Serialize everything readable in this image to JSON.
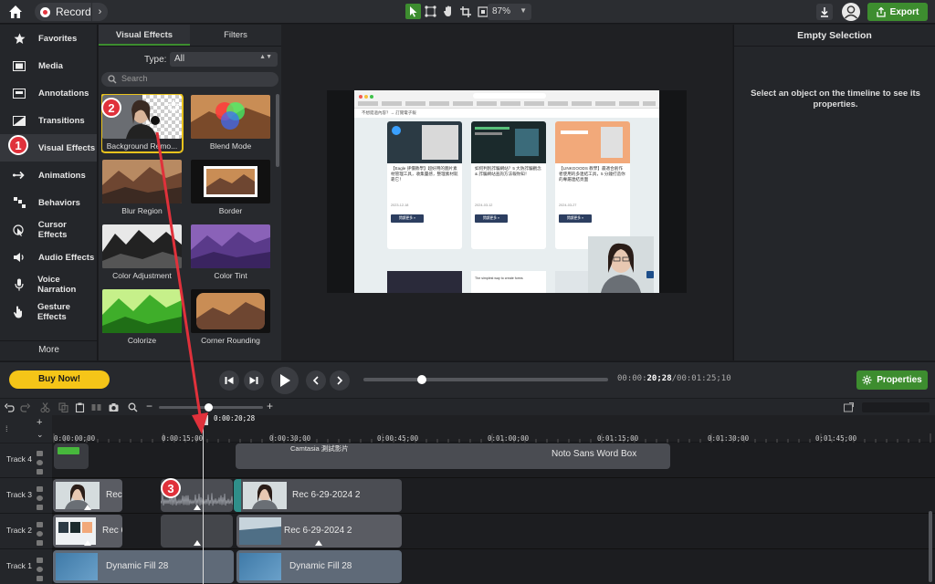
{
  "topbar": {
    "record_label": "Record",
    "zoom_value": "87%",
    "export_label": "Export"
  },
  "nav": {
    "items": [
      {
        "label": "Favorites",
        "icon": "star-icon"
      },
      {
        "label": "Media",
        "icon": "film-icon"
      },
      {
        "label": "Annotations",
        "icon": "annotation-icon"
      },
      {
        "label": "Transitions",
        "icon": "transition-icon"
      },
      {
        "label": "Visual Effects",
        "icon": "sparkle-icon"
      },
      {
        "label": "Animations",
        "icon": "arrow-icon"
      },
      {
        "label": "Behaviors",
        "icon": "behaviors-icon"
      },
      {
        "label": "Cursor Effects",
        "icon": "cursor-icon"
      },
      {
        "label": "Audio Effects",
        "icon": "speaker-icon"
      },
      {
        "label": "Voice Narration",
        "icon": "microphone-icon"
      },
      {
        "label": "Gesture Effects",
        "icon": "hand-icon"
      }
    ],
    "more_label": "More"
  },
  "effects": {
    "tab_visual": "Visual Effects",
    "tab_filters": "Filters",
    "type_label": "Type:",
    "type_value": "All",
    "search_placeholder": "Search",
    "thumbs": [
      "Background Remo...",
      "Blend Mode",
      "Blur Region",
      "Border",
      "Color Adjustment",
      "Color Tint",
      "Colorize",
      "Corner Rounding"
    ]
  },
  "canvas": {
    "page_heading": "不想錯過內容？→ 訂閱電子報",
    "cards": [
      {
        "title": "【Eagle 評價教學】超好用的圖片素材管理工具，收集靈感，整理素材就靠它！",
        "meta": "2023-12-18",
        "button": "閱讀更多 »"
      },
      {
        "title": "如何判別詐騙網站？5 大防詐騙觀念 & 詐騙網站查詢方法報你知！",
        "meta": "2024-03-12",
        "button": "閱讀更多 »"
      },
      {
        "title": "【LINKGOODS 教學】最適合創作者使用的多連結工具，5 分鐘打造你的專屬連結頁面",
        "meta": "2024-03-27",
        "button": "閱讀更多 »"
      }
    ],
    "sub_caption": "The simplest way to create forms"
  },
  "props": {
    "title": "Empty Selection",
    "message": "Select an object on the timeline to see its properties."
  },
  "playback": {
    "buy_label": "Buy Now!",
    "time_current": "20;28",
    "time_prefix": "00:00:",
    "time_total": "/00:01:25;10",
    "properties_label": "Properties",
    "progress": 0.24
  },
  "timeline": {
    "playhead_time": "0:00:20;28",
    "ruler": [
      "0:00:00;00",
      "0:00:15;00",
      "0:00:30;00",
      "0:00:45;00",
      "0:01:00;00",
      "0:01:15;00",
      "0:01:30;00",
      "0:01:45;00"
    ],
    "tracks": [
      "Track 4",
      "Track 3",
      "Track 2",
      "Track 1"
    ],
    "clips": {
      "t4_text_label": "Camtasia 測試影片",
      "t4_box_label": "Noto Sans Word Box",
      "t3_clip1": "Rec",
      "t3_clip2": "Rec 6-29-2024 2",
      "t2_clip1": "Rec 6",
      "t2_clip3": "Rec 6-29-2024 2",
      "t1_clip1": "Dynamic Fill 28",
      "t1_clip2": "Dynamic Fill 28"
    }
  },
  "annotations": {
    "badge1": "1",
    "badge2": "2",
    "badge3": "3"
  },
  "colors": {
    "accent_green": "#3d8d2f",
    "annotation_red": "#e0313b",
    "buy_yellow": "#f5c518"
  }
}
